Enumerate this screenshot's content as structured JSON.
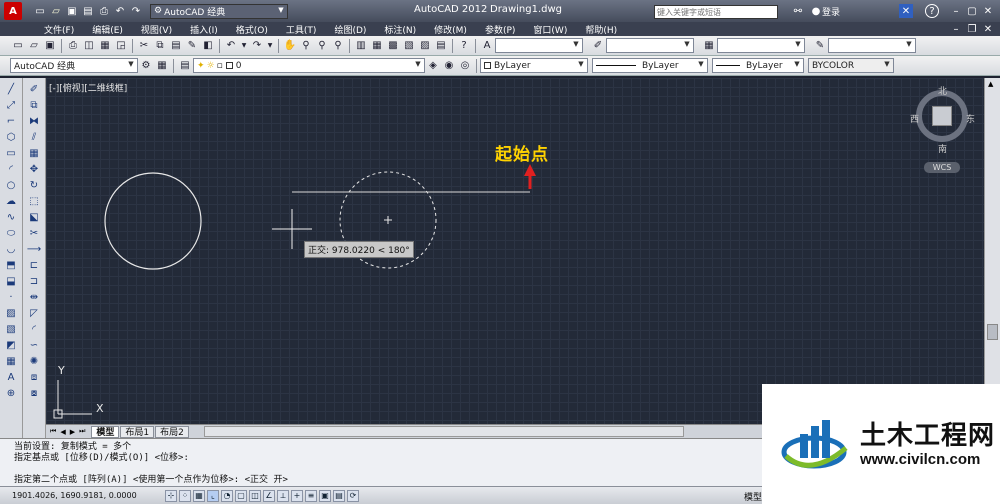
{
  "titlebar": {
    "workspace": "AutoCAD 经典",
    "app_title": "AutoCAD 2012",
    "doc_title": "Drawing1.dwg",
    "search_placeholder": "键入关键字或短语",
    "login": "登录"
  },
  "menubar": {
    "items": [
      "文件(F)",
      "编辑(E)",
      "视图(V)",
      "插入(I)",
      "格式(O)",
      "工具(T)",
      "绘图(D)",
      "标注(N)",
      "修改(M)",
      "参数(P)",
      "窗口(W)",
      "帮助(H)"
    ]
  },
  "toolbar2": {
    "workspace_value": "AutoCAD 经典",
    "layer_value": "0",
    "color_value": "ByLayer",
    "linetype_value": "ByLayer",
    "lineweight_value": "ByLayer",
    "plotstyle_value": "BYCOLOR"
  },
  "viewport": {
    "label": "[-][俯视][二维线框]",
    "annotation": "起始点",
    "ortho_tooltip": "正交: 978.0220 < 180°"
  },
  "viewcube": {
    "north": "北",
    "south": "南",
    "east": "东",
    "west": "西",
    "wcs": "WCS"
  },
  "ucs": {
    "x_label": "X",
    "y_label": "Y"
  },
  "layout_tabs": [
    "模型",
    "布局1",
    "布局2"
  ],
  "command": {
    "line1": "当前设置:  复制模式 = 多个",
    "line2": "指定基点或 [位移(D)/模式(O)] <位移>:",
    "line3": "指定第二个点或 [阵列(A)] <使用第一个点作为位移>: <正交 开>"
  },
  "status": {
    "coords": "1901.4026, 1690.9181, 0.0000",
    "model": "模型"
  },
  "watermark": {
    "brand": "土木工程网",
    "url": "www.civilcn.com"
  },
  "colors": {
    "annotation": "#ffd200",
    "arrow": "#e02020",
    "canvas": "#232a38"
  }
}
